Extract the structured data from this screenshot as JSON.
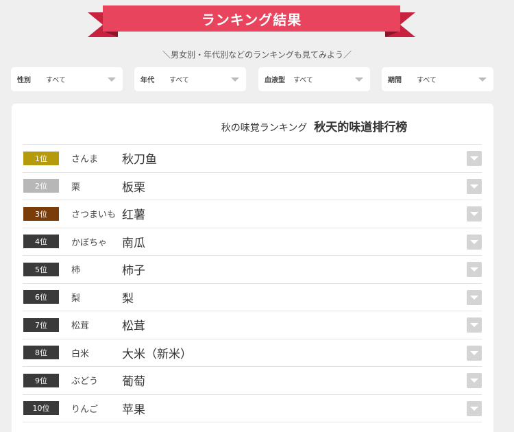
{
  "banner": {
    "title": "ランキング結果"
  },
  "subtitle": "＼男女別・年代別などのランキングも見てみよう／",
  "filters": [
    {
      "label": "性別",
      "value": "すべて"
    },
    {
      "label": "年代",
      "value": "すべて"
    },
    {
      "label": "血液型",
      "value": "すべて"
    },
    {
      "label": "期間",
      "value": "すべて"
    }
  ],
  "card": {
    "title_jp": "秋の味覚ランキング",
    "title_zh": "秋天的味道排行榜"
  },
  "rankings": [
    {
      "rank": "1位",
      "jp": "さんま",
      "zh": "秋刀鱼",
      "color": "#b59a0b"
    },
    {
      "rank": "2位",
      "jp": "栗",
      "zh": "板栗",
      "color": "#b7b7b7"
    },
    {
      "rank": "3位",
      "jp": "さつまいも",
      "zh": "红薯",
      "color": "#7a3d0a"
    },
    {
      "rank": "4位",
      "jp": "かぼちゃ",
      "zh": "南瓜",
      "color": "#3a3a3a"
    },
    {
      "rank": "5位",
      "jp": "柿",
      "zh": "柿子",
      "color": "#3a3a3a"
    },
    {
      "rank": "6位",
      "jp": "梨",
      "zh": "梨",
      "color": "#3a3a3a"
    },
    {
      "rank": "7位",
      "jp": "松茸",
      "zh": "松茸",
      "color": "#3a3a3a"
    },
    {
      "rank": "8位",
      "jp": "白米",
      "zh": "大米（新米）",
      "color": "#3a3a3a"
    },
    {
      "rank": "9位",
      "jp": "ぶどう",
      "zh": "葡萄",
      "color": "#3a3a3a"
    },
    {
      "rank": "10位",
      "jp": "りんご",
      "zh": "苹果",
      "color": "#3a3a3a"
    }
  ],
  "icons": {
    "filter_caret": "chevron-down-icon",
    "row_expand": "expand-toggle-icon"
  }
}
